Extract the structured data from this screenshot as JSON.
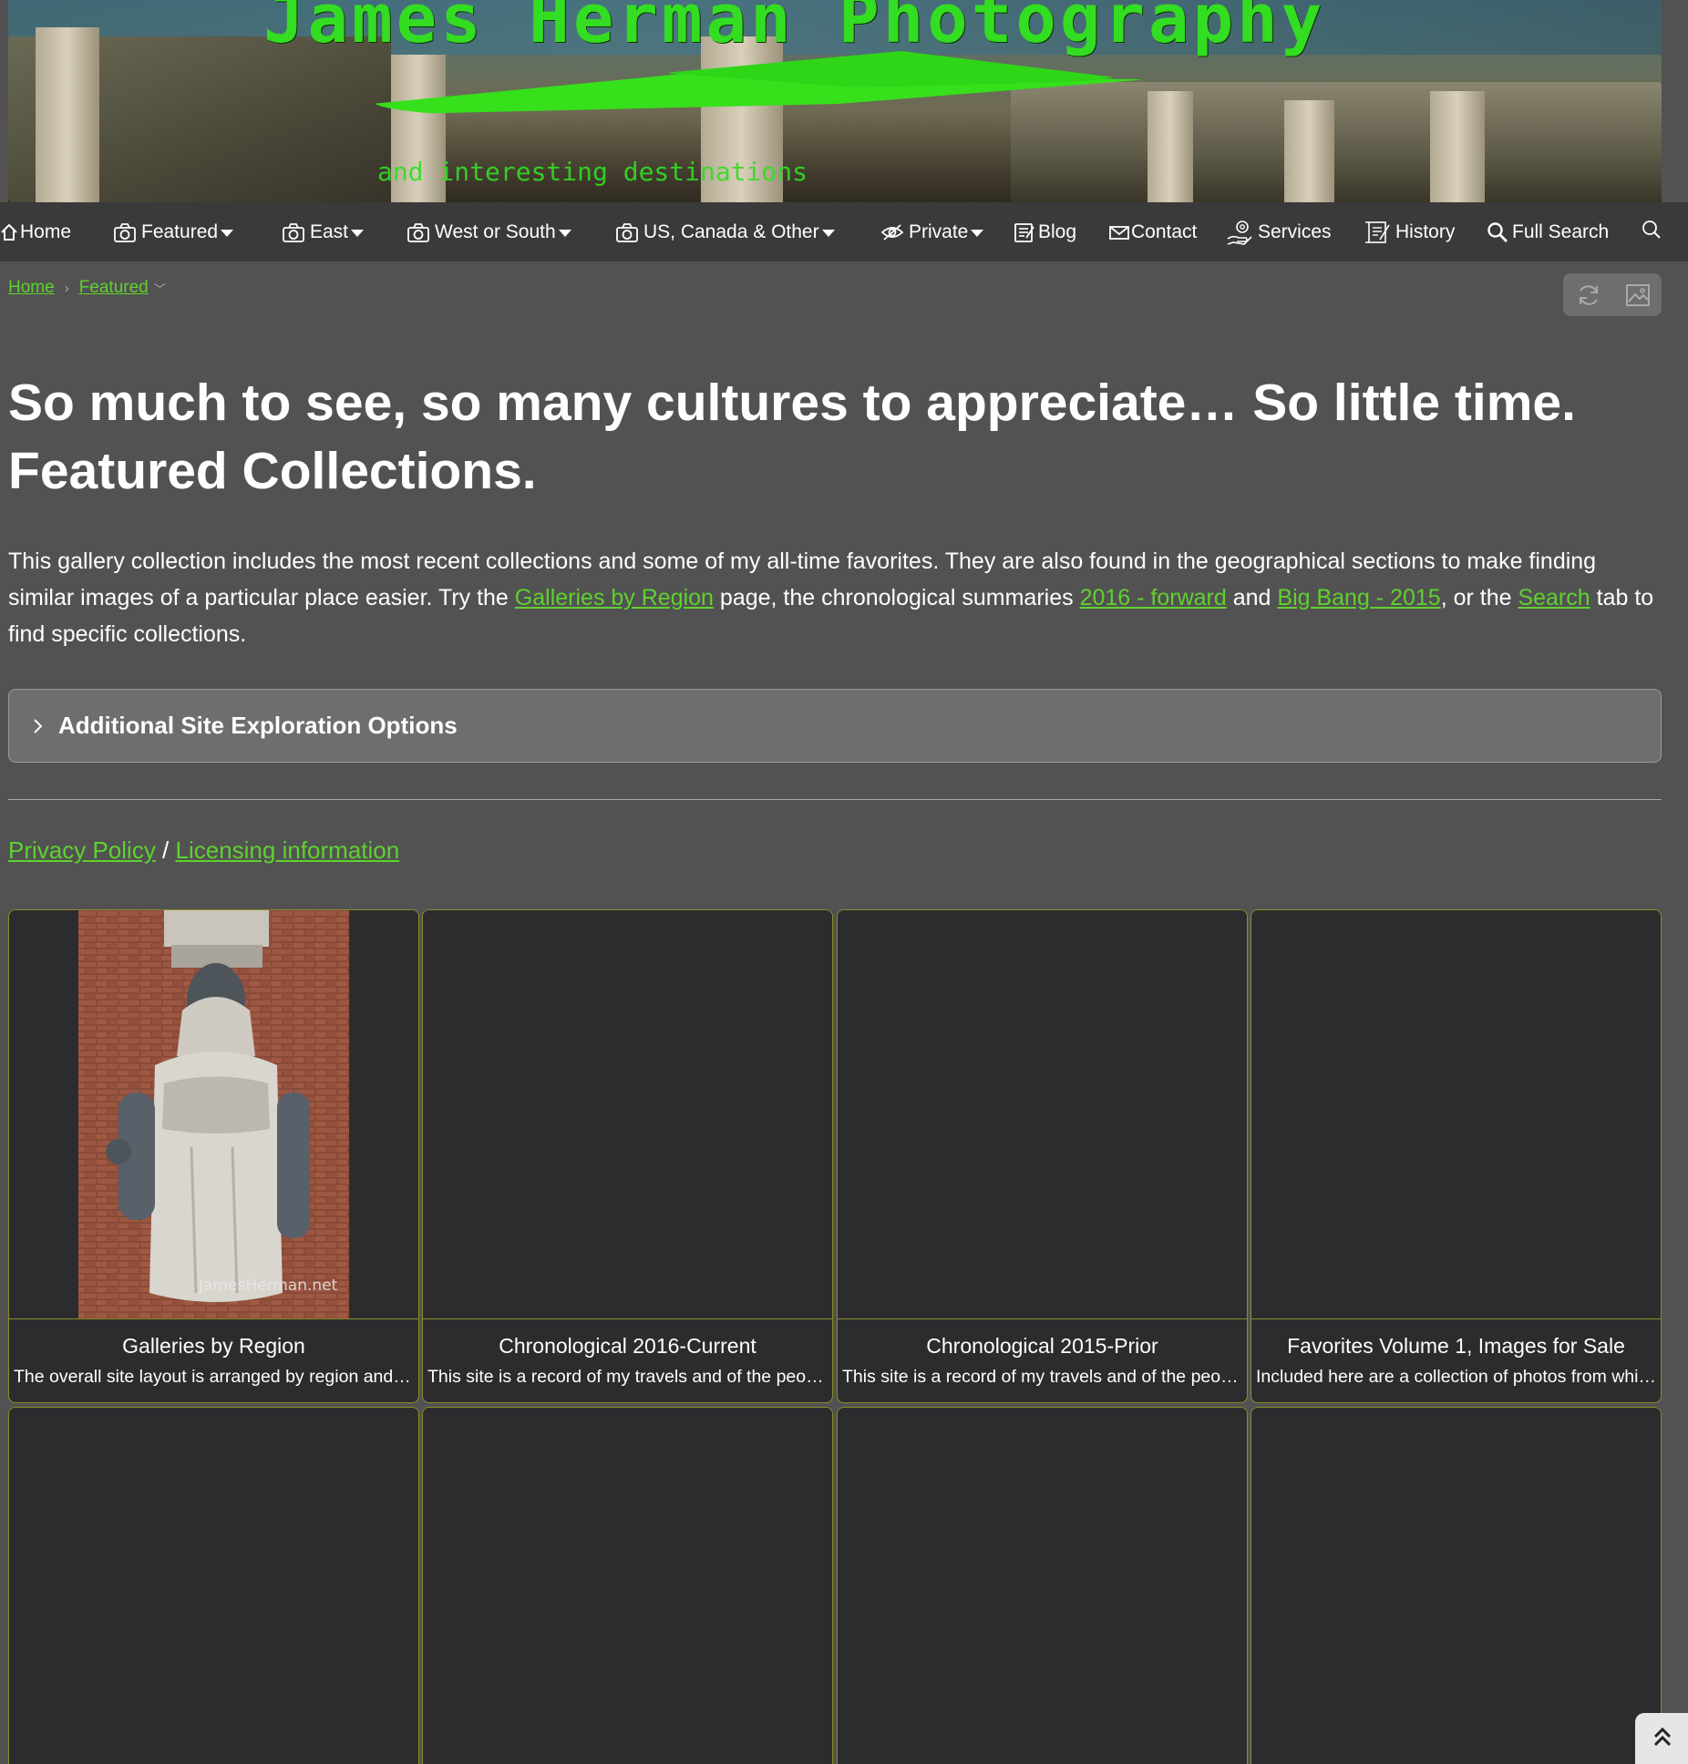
{
  "banner": {
    "title": "James Herman Photography",
    "tagline": "and interesting destinations",
    "title_color": "#33dd22"
  },
  "nav": {
    "items": [
      {
        "label": "Home",
        "icon": "home-icon"
      },
      {
        "label": "Featured",
        "icon": "camera-icon",
        "dropdown": true
      },
      {
        "label": "East",
        "icon": "camera-icon",
        "dropdown": true
      },
      {
        "label": "West or South",
        "icon": "camera-icon",
        "dropdown": true
      },
      {
        "label": "US, Canada & Other",
        "icon": "camera-icon",
        "dropdown": true
      },
      {
        "label": "Private",
        "icon": "hidden-eye-icon",
        "dropdown": true
      },
      {
        "label": "Blog",
        "icon": "blog-icon"
      },
      {
        "label": "Contact",
        "icon": "envelope-icon"
      },
      {
        "label": "Services",
        "icon": "services-icon"
      },
      {
        "label": "History",
        "icon": "history-icon"
      },
      {
        "label": "Full Search",
        "icon": "magnifier-icon"
      }
    ],
    "search_icon": "search-icon"
  },
  "breadcrumb": {
    "home": "Home",
    "current": "Featured"
  },
  "heading": {
    "line1": "So much to see, so many cultures to appreciate… So little time.",
    "line2": "Featured Collections."
  },
  "intro": {
    "part1": "This gallery collection includes the most recent collections and some of my all-time favorites. They are also found in the geographical sections to make finding similar images of a particular place easier. Try the ",
    "link1": "Galleries by Region",
    "part2": " page, the chronological summaries ",
    "link2": "2016 - forward",
    "part3": " and ",
    "link3": "Big Bang - 2015",
    "part4": ", or the ",
    "link4": "Search",
    "part5": " tab to find specific collections."
  },
  "accordion": {
    "label": "Additional Site Exploration Options"
  },
  "footer_links": {
    "privacy": "Privacy Policy",
    "separator": " / ",
    "licensing": "Licensing information"
  },
  "cards": [
    {
      "title": "Galleries by Region",
      "desc": "The overall site layout is arranged by region and then by country.",
      "has_image": true,
      "watermark": "JamesHerman.net"
    },
    {
      "title": "Chronological 2016-Current",
      "desc": "This site is a record of my travels and of the people and places I have seen.",
      "has_image": false
    },
    {
      "title": "Chronological 2015-Prior",
      "desc": "This site is a record of my travels and of the people and places I have seen.",
      "has_image": false
    },
    {
      "title": "Favorites Volume 1, Images for Sale",
      "desc": "Included here are a collection of photos from which prints may be purchased.",
      "has_image": false
    },
    {
      "title": "",
      "desc": "",
      "has_image": false
    },
    {
      "title": "",
      "desc": "",
      "has_image": false
    },
    {
      "title": "",
      "desc": "",
      "has_image": false
    },
    {
      "title": "",
      "desc": "",
      "has_image": false
    }
  ],
  "colors": {
    "background": "#525252",
    "nav_bg": "#3a3a3a",
    "link": "#5fd12f",
    "card_bg": "#2c2c2e",
    "card_border": "#8c8c2a"
  }
}
